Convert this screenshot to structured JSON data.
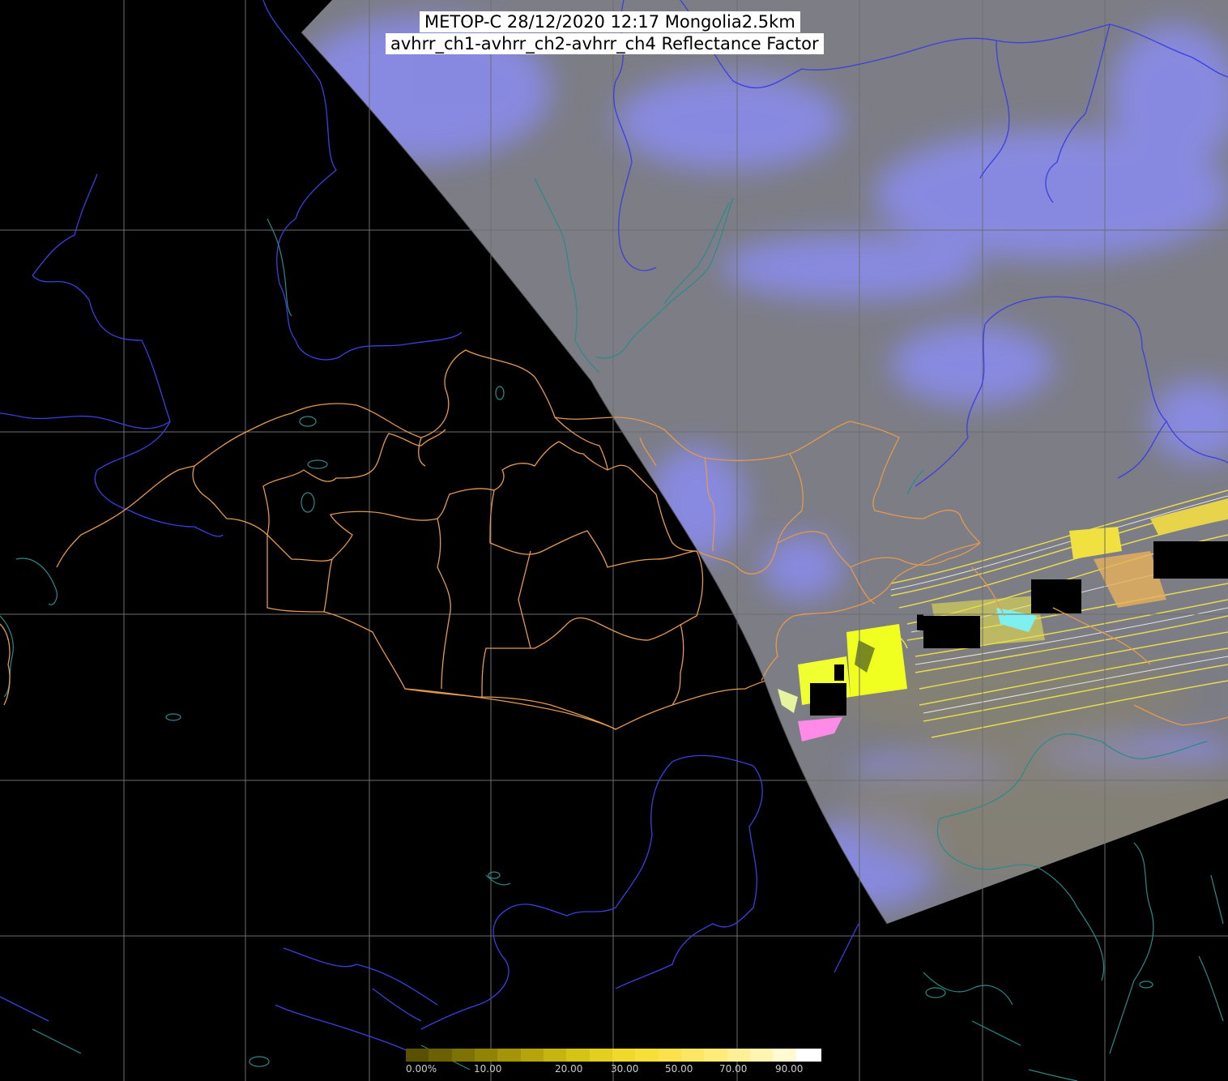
{
  "title": {
    "line1": "METOP-C 28/12/2020 12:17 Mongolia2.5km",
    "line2": "avhrr_ch1-avhrr_ch2-avhrr_ch4 Reflectance Factor"
  },
  "legend": {
    "ticks": [
      "0.00%",
      "10.00",
      "20.00",
      "30.00",
      "50.00",
      "70.00",
      "90.00"
    ],
    "colors": [
      "#5a5100",
      "#6b6102",
      "#7e7204",
      "#908306",
      "#a39408",
      "#b5a50b",
      "#c6b50f",
      "#d6c414",
      "#e3d01e",
      "#efd92a",
      "#f7df3a",
      "#fbe24d",
      "#fde762",
      "#feeb7a",
      "#fff095",
      "#fff5b3",
      "#fffad2",
      "#ffffff"
    ]
  },
  "colors": {
    "background": "#000000",
    "satellite_overlay": "#7c7d85",
    "cloud_tint": "#8a8cf0",
    "grid": "#6e6e6e",
    "admin_boundary": "#e39a50",
    "river": "#3a3fe0",
    "coast": "#2b8a8a"
  }
}
